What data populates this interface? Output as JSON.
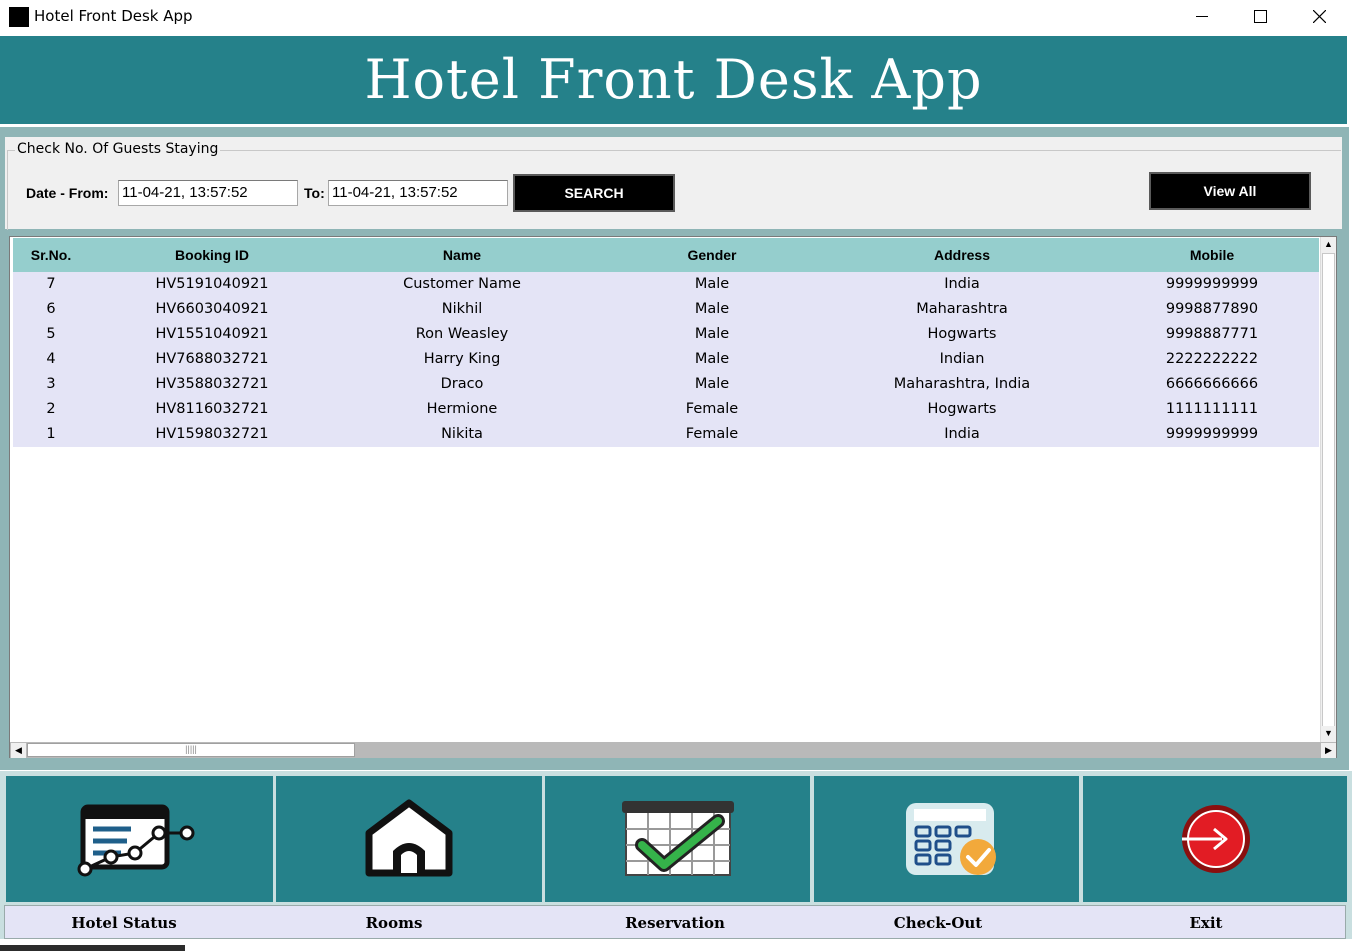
{
  "window": {
    "title": "Hotel Front Desk App",
    "controls": [
      "minimize-icon",
      "maximize-icon",
      "close-icon"
    ]
  },
  "header": {
    "title": "Hotel Front Desk App"
  },
  "search": {
    "group_label": "Check No. Of Guests Staying",
    "from_label": "Date - From:",
    "from_value": "11-04-21, 13:57:52",
    "to_label": "To:",
    "to_value": "11-04-21, 13:57:52",
    "search_button": "SEARCH",
    "view_all_button": "View All"
  },
  "table": {
    "columns": [
      "Sr.No.",
      "Booking ID",
      "Name",
      "Gender",
      "Address",
      "Mobile"
    ],
    "rows": [
      {
        "sr": "7",
        "booking_id": "HV5191040921",
        "name": "Customer Name",
        "gender": "Male",
        "address": "India",
        "mobile": "9999999999"
      },
      {
        "sr": "6",
        "booking_id": "HV6603040921",
        "name": "Nikhil",
        "gender": "Male",
        "address": "Maharashtra",
        "mobile": "9998877890"
      },
      {
        "sr": "5",
        "booking_id": "HV1551040921",
        "name": "Ron Weasley",
        "gender": "Male",
        "address": "Hogwarts",
        "mobile": "9998887771"
      },
      {
        "sr": "4",
        "booking_id": "HV7688032721",
        "name": "Harry King",
        "gender": "Male",
        "address": "Indian",
        "mobile": "2222222222"
      },
      {
        "sr": "3",
        "booking_id": "HV3588032721",
        "name": "Draco",
        "gender": "Male",
        "address": "Maharashtra, India",
        "mobile": "6666666666"
      },
      {
        "sr": "2",
        "booking_id": "HV8116032721",
        "name": "Hermione",
        "gender": "Female",
        "address": "Hogwarts",
        "mobile": "1111111111"
      },
      {
        "sr": "1",
        "booking_id": "HV1598032721",
        "name": "Nikita",
        "gender": "Female",
        "address": "India",
        "mobile": "9999999999"
      }
    ]
  },
  "nav": {
    "items": [
      {
        "label": "Hotel Status",
        "icon": "hotel-status-icon"
      },
      {
        "label": "Rooms",
        "icon": "home-icon"
      },
      {
        "label": "Reservation",
        "icon": "calendar-check-icon"
      },
      {
        "label": "Check-Out",
        "icon": "calculator-icon"
      },
      {
        "label": "Exit",
        "icon": "exit-icon"
      }
    ]
  },
  "colors": {
    "header_bg": "#25818a",
    "table_header_bg": "#95cecd",
    "row_bg": "#e4e4f6",
    "button_bg": "#000000"
  }
}
